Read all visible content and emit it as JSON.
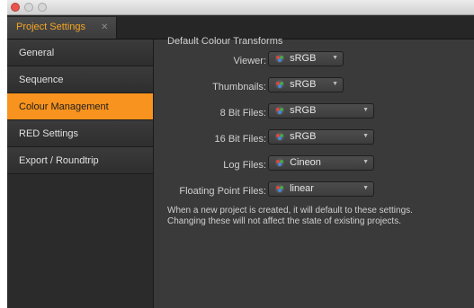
{
  "window": {
    "tab_label": "Project Settings",
    "tab_close": "✕"
  },
  "sidebar": {
    "items": [
      {
        "label": "General",
        "active": false
      },
      {
        "label": "Sequence",
        "active": false
      },
      {
        "label": "Colour Management",
        "active": true
      },
      {
        "label": "RED Settings",
        "active": false
      },
      {
        "label": "Export / Roundtrip",
        "active": false
      }
    ]
  },
  "main": {
    "section_title": "Default Colour Transforms",
    "rows": [
      {
        "label": "Viewer:",
        "value": "sRGB"
      },
      {
        "label": "Thumbnails:",
        "value": "sRGB"
      },
      {
        "label": "8 Bit Files:",
        "value": "sRGB"
      },
      {
        "label": "16 Bit Files:",
        "value": "sRGB"
      },
      {
        "label": "Log Files:",
        "value": "Cineon"
      },
      {
        "label": "Floating Point Files:",
        "value": "linear"
      }
    ],
    "info_line1": "When a new project is created, it will default to these settings.",
    "info_line2": "Changing these will not affect the state of existing projects."
  },
  "colors": {
    "accent": "#f7931e",
    "tab_text": "#f5a623",
    "background": "#3a3a3a"
  },
  "icons": {
    "dropdown_icon": "colour-wheel-icon",
    "dropdown_arrow": "chevron-down-icon"
  }
}
